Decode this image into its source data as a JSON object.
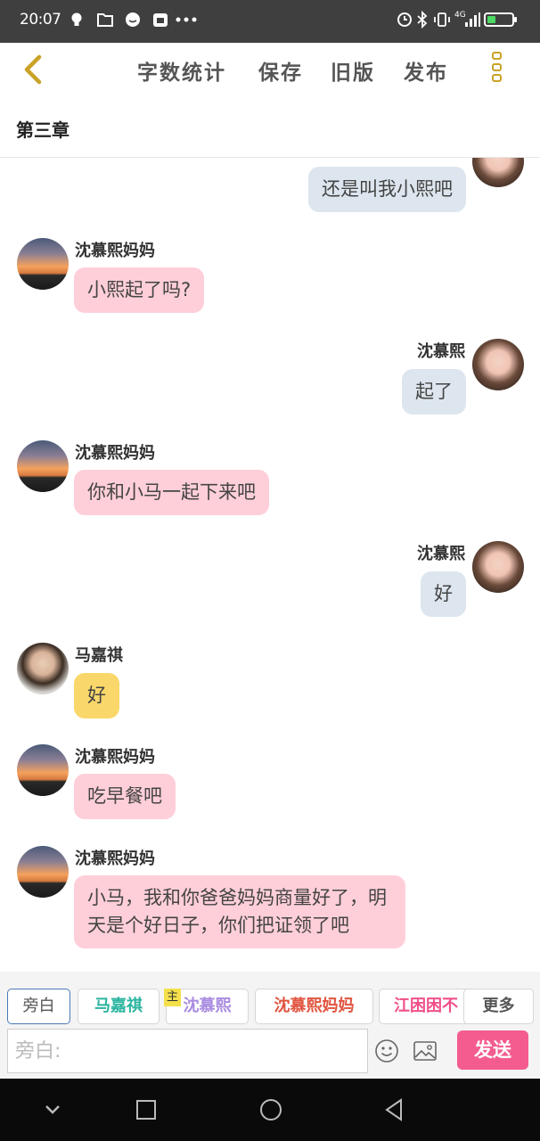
{
  "status_bar": {
    "time": "20:07",
    "left_icons": [
      "lightbulb-icon",
      "folder-icon",
      "message-icon",
      "app-icon",
      "more-dots-icon"
    ],
    "right_icons": [
      "alarm-icon",
      "bluetooth-icon",
      "vibrate-icon",
      "signal-icon",
      "battery-icon"
    ],
    "network": "4G",
    "battery_level": 0.35
  },
  "header": {
    "back_icon": "chevron-left-icon",
    "menu": [
      "字数统计",
      "保存",
      "旧版",
      "发布"
    ],
    "more_icon": "vertical-dots-icon"
  },
  "chapter": {
    "title": "第三章"
  },
  "messages": [
    {
      "side": "right",
      "sender": "",
      "text": "还是叫我小熙吧",
      "color": "blue"
    },
    {
      "side": "left",
      "sender": "沈慕熙妈妈",
      "text": "小熙起了吗?",
      "color": "pink"
    },
    {
      "side": "right",
      "sender": "沈慕熙",
      "text": "起了",
      "color": "blue"
    },
    {
      "side": "left",
      "sender": "沈慕熙妈妈",
      "text": "你和小马一起下来吧",
      "color": "pink"
    },
    {
      "side": "right",
      "sender": "沈慕熙",
      "text": "好",
      "color": "blue"
    },
    {
      "side": "left",
      "sender": "马嘉祺",
      "text": "好",
      "color": "yellow"
    },
    {
      "side": "left",
      "sender": "沈慕熙妈妈",
      "text": "吃早餐吧",
      "color": "pink"
    },
    {
      "side": "left",
      "sender": "沈慕熙妈妈",
      "text": "小马，我和你爸爸妈妈商量好了，明天是个好日子，你们把证领了吧",
      "color": "pink"
    }
  ],
  "roles": {
    "tabs": [
      {
        "label": "旁白",
        "color": "#555555"
      },
      {
        "label": "马嘉祺",
        "color": "#2bb5a0"
      },
      {
        "label": "沈慕熙",
        "color": "#a98be0"
      },
      {
        "label": "沈慕熙妈妈",
        "color": "#e0543f"
      },
      {
        "label": "江困困不",
        "color": "#f0508a"
      },
      {
        "label": "更多",
        "color": "#555555"
      }
    ],
    "main_badge": "主"
  },
  "input": {
    "placeholder": "旁白:",
    "emoji_icon": "emoji-icon",
    "image_icon": "image-icon",
    "send_label": "发送"
  },
  "nav_bar": {
    "icons": [
      "chevron-down-icon",
      "square-icon",
      "circle-icon",
      "triangle-back-icon"
    ]
  },
  "colors": {
    "pink_bubble": "#ffcfd9",
    "blue_bubble": "#dde6ef",
    "yellow_bubble": "#fad76a",
    "send": "#f45c8f",
    "accent": "#c9a227"
  }
}
